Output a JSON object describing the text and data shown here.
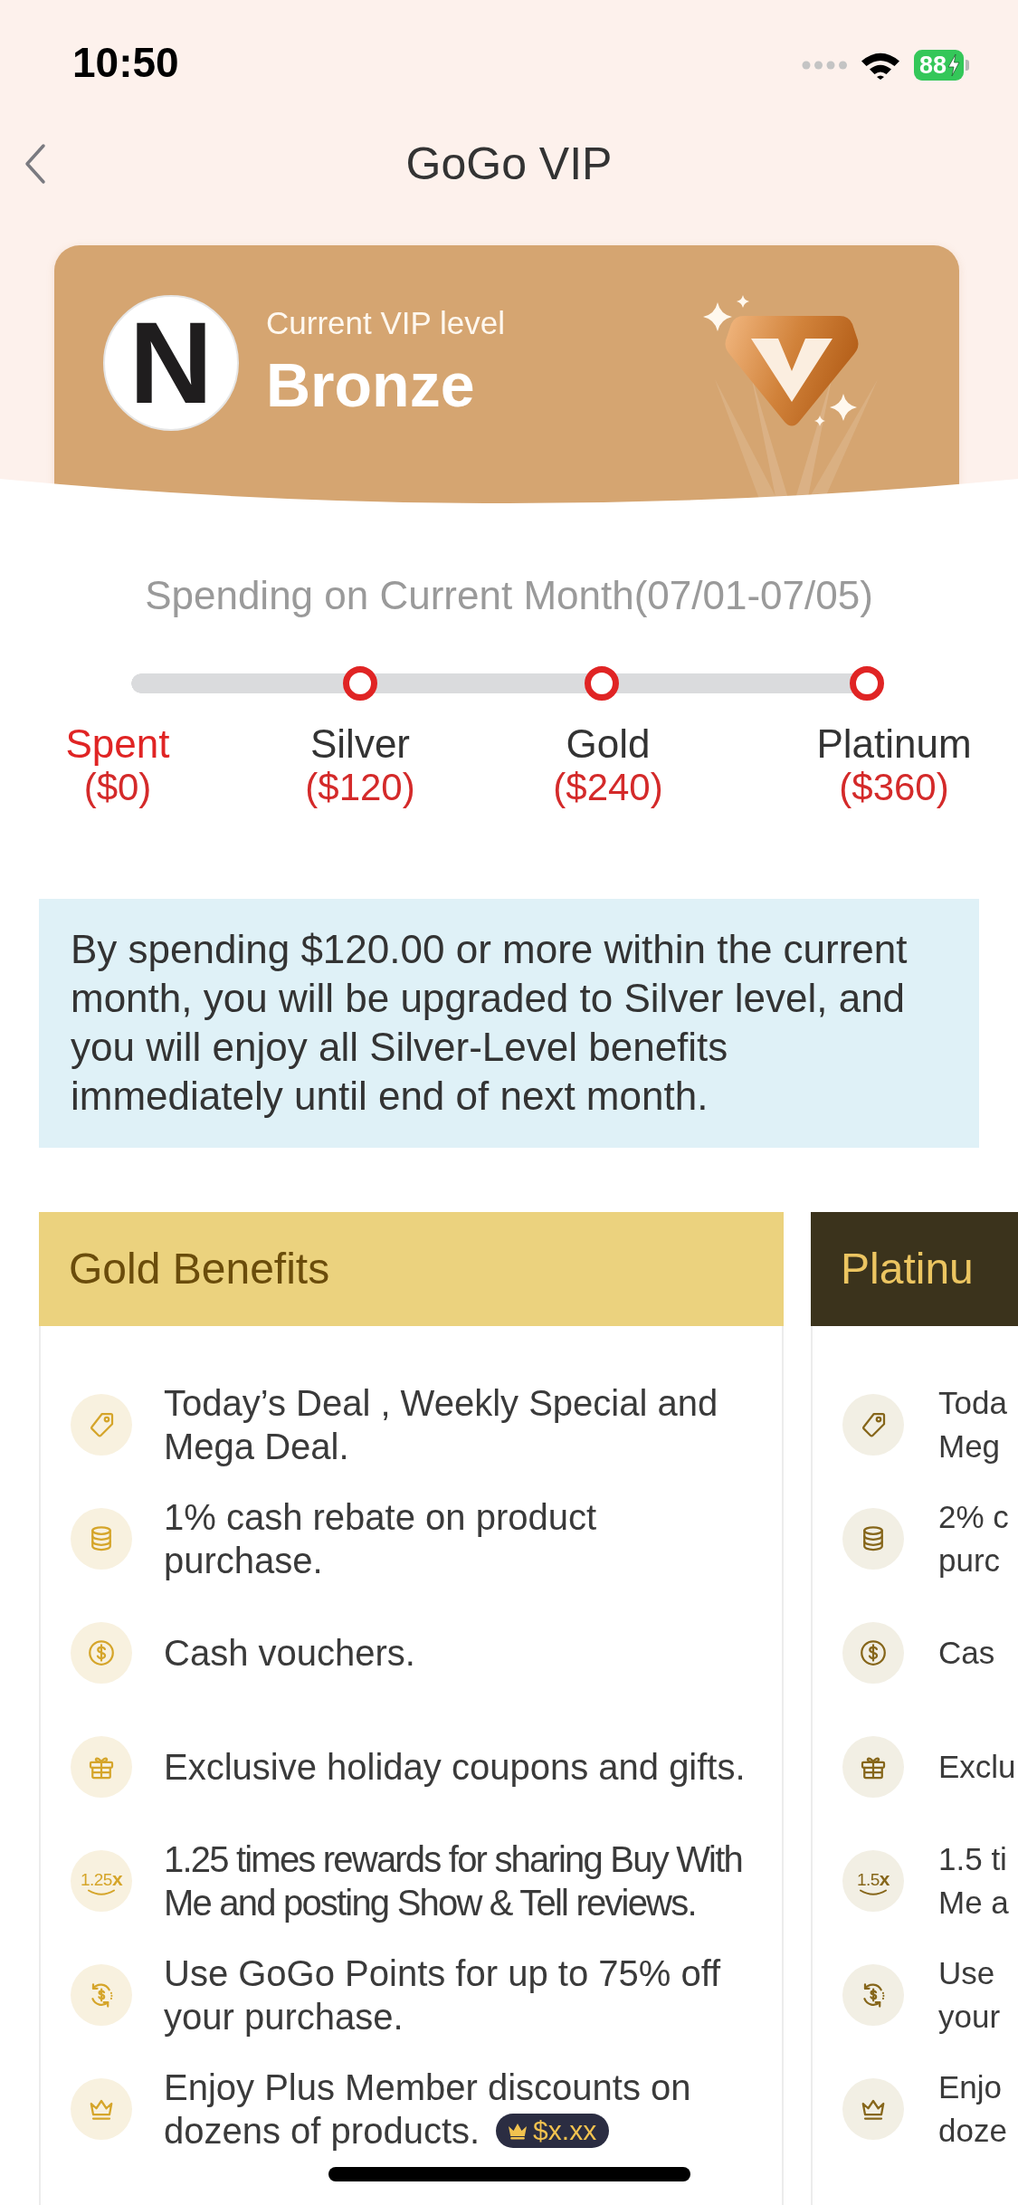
{
  "status_bar": {
    "time": "10:50",
    "battery": "88",
    "charging": true
  },
  "header": {
    "title": "GoGo VIP"
  },
  "vip_card": {
    "avatar_letter": "N",
    "label": "Current VIP level",
    "level_name": "Bronze"
  },
  "spending": {
    "title": "Spending on Current Month(07/01-07/05)",
    "milestones": [
      {
        "kind": "spent",
        "name": "Spent",
        "amount": "($0)"
      },
      {
        "kind": "tier",
        "name": "Silver",
        "amount": "($120)"
      },
      {
        "kind": "tier",
        "name": "Gold",
        "amount": "($240)"
      },
      {
        "kind": "tier",
        "name": "Platinum",
        "amount": "($360)"
      }
    ]
  },
  "notice": {
    "text": "By spending $120.00 or more within the current month, you will be upgraded to Silver level, and you will enjoy all Silver-Level benefits immediately until end of next month."
  },
  "benefit_cards": [
    {
      "kind": "gold",
      "title": "Gold Benefits",
      "items": [
        {
          "kind": "tag",
          "text": "Today’s Deal , Weekly Special and Mega Deal."
        },
        {
          "kind": "coins",
          "text": "1% cash rebate on product purchase."
        },
        {
          "kind": "dollar",
          "text": "Cash vouchers."
        },
        {
          "kind": "gift",
          "text": "Exclusive holiday coupons and gifts."
        },
        {
          "kind": "multiplier",
          "icon_label": "1.25**x**",
          "text": "1.25 times rewards for sharing Buy With Me and posting Show & Tell reviews."
        },
        {
          "kind": "exchange",
          "text": "Use GoGo Points for up to 75% off your purchase."
        },
        {
          "kind": "crown",
          "text": "Enjoy Plus Member discounts on dozens of products.",
          "badge": "$x.xx"
        }
      ]
    },
    {
      "kind": "platinum",
      "title": "Platinu",
      "items": [
        {
          "kind": "tag",
          "lines": [
            "Toda",
            "Meg"
          ]
        },
        {
          "kind": "coins",
          "lines": [
            "2% c",
            "purc"
          ]
        },
        {
          "kind": "dollar",
          "lines": [
            "Cas"
          ]
        },
        {
          "kind": "gift",
          "lines": [
            "Exclu"
          ]
        },
        {
          "kind": "multiplier",
          "icon_label": "1.5**x**",
          "lines": [
            "1.5 ti",
            "Me a"
          ]
        },
        {
          "kind": "exchange",
          "lines": [
            "Use",
            "your"
          ]
        },
        {
          "kind": "crown",
          "lines": [
            "Enjo",
            "doze"
          ]
        }
      ]
    }
  ]
}
